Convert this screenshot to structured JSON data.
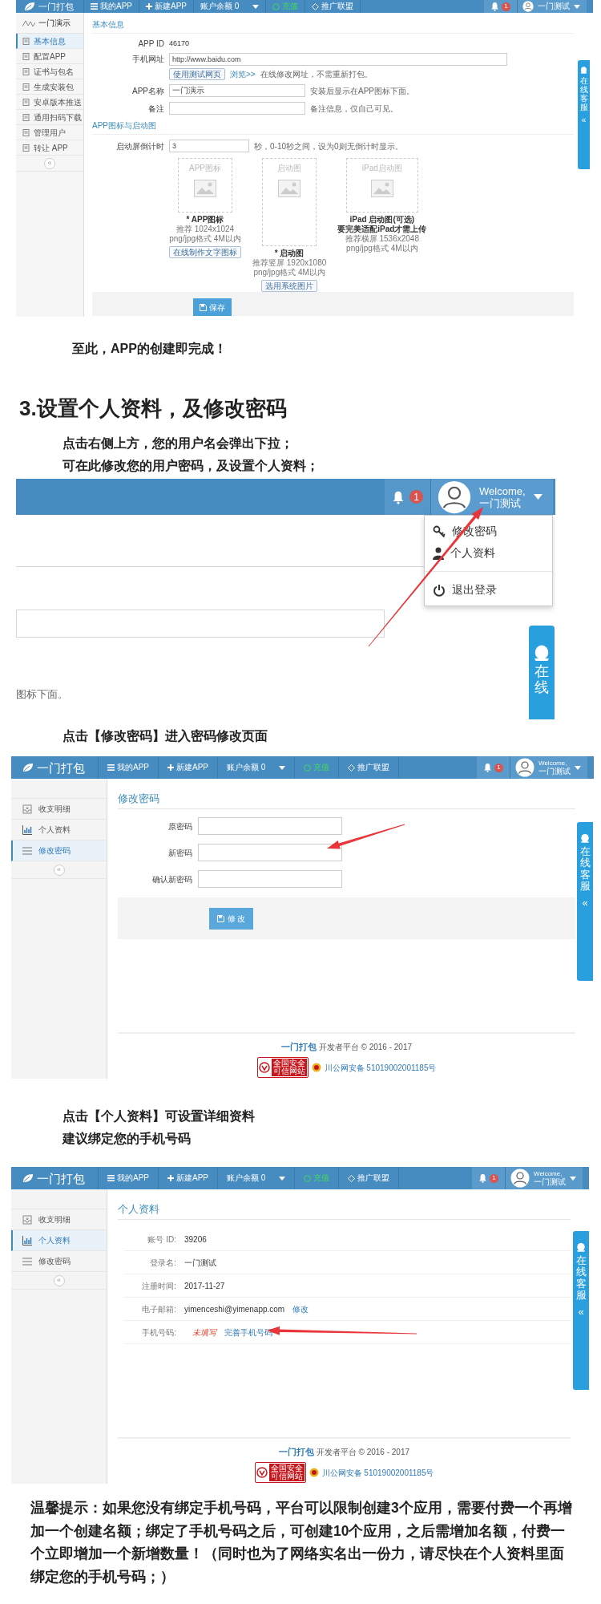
{
  "shot_app_settings": {
    "navbar": {
      "logo": "一门打包",
      "items": [
        {
          "kind": "menu",
          "label": "我的APP"
        },
        {
          "kind": "add",
          "label": "新建APP"
        },
        {
          "kind": "dropdown",
          "label": "账户余额 0"
        },
        {
          "kind": "recharge",
          "label": "充值"
        },
        {
          "kind": "promo",
          "label": "推广联盟"
        }
      ],
      "notification_count": "1",
      "user_name": "一门测试"
    },
    "sidebar": {
      "title": "一门演示",
      "items": [
        {
          "label": "基本信息",
          "selected": true
        },
        {
          "label": "配置APP",
          "selected": false
        },
        {
          "label": "证书与包名",
          "selected": false
        },
        {
          "label": "生成安装包",
          "selected": false
        },
        {
          "label": "安卓版本推送",
          "selected": false
        },
        {
          "label": "通用扫码下载",
          "selected": false
        },
        {
          "label": "管理用户",
          "selected": false
        },
        {
          "label": "转让 APP",
          "selected": false
        }
      ],
      "collapse": "«"
    },
    "basic_info": {
      "title": "基本信息",
      "app_id": {
        "label": "APP ID",
        "value": "46170"
      },
      "mobile_url": {
        "label": "手机网址",
        "value": "http://www.baidu.com",
        "test_button": "使用测试网页",
        "browse_link": "浏览>>",
        "hint": "在线修改网址，不需重新打包。"
      },
      "app_name": {
        "label": "APP名称",
        "value": "一门演示",
        "hint": "安装后显示在APP图标下面。"
      },
      "remark": {
        "label": "备注",
        "hint": "备注信息，仅自己可见。"
      }
    },
    "icons_section": {
      "title": "APP图标与启动图",
      "countdown": {
        "label": "启动屏倒计时",
        "value": "3",
        "hint": "秒，0-10秒之间，设为0则无倒计时显示。"
      },
      "uploads": [
        {
          "kind": "square",
          "box_label": "APP图标",
          "captions": [
            "* APP图标"
          ],
          "notes": [
            "推荐 1024x1024",
            "png/jpg格式 4M以内"
          ],
          "button": "在线制作文字图标"
        },
        {
          "kind": "tall",
          "box_label": "启动图",
          "captions": [
            "* 启动图"
          ],
          "notes": [
            "推荐竖屏 1920x1080",
            "png/jpg格式 4M以内"
          ],
          "button": "选用系统图片"
        },
        {
          "kind": "wide",
          "box_label": "iPad启动图",
          "captions": [
            "iPad 启动图(可选)",
            "要完美适配iPad才需上传"
          ],
          "notes": [
            "推荐横屏 1536x2048",
            "png/jpg格式 4M以内"
          ]
        }
      ]
    },
    "save_button": "保存",
    "support_tab": {
      "label": "在线客服",
      "arrow": "«"
    }
  },
  "completion_note": "至此，APP的创建即完成！",
  "section_heading": "3.设置个人资料，及修改密码",
  "section_intro": [
    "点击右侧上方，您的用户名会弹出下拉；",
    "可在此修改您的用户密码，及设置个人资料；"
  ],
  "shot_user_menu": {
    "notification_count": "1",
    "greeting": "Welcome,",
    "user_name": "一门测试",
    "menu": [
      {
        "kind": "key",
        "label": "修改密码"
      },
      {
        "kind": "user",
        "label": "个人资料"
      },
      {
        "kind": "divider"
      },
      {
        "kind": "power",
        "label": "退出登录"
      }
    ],
    "background_text": "图标下面。",
    "support_tab": {
      "label": "在线"
    }
  },
  "password_intro": [
    "点击【修改密码】进入密码修改页面"
  ],
  "shot_change_password": {
    "navbar": {
      "logo": "一门打包",
      "items": [
        {
          "kind": "menu",
          "label": "我的APP"
        },
        {
          "kind": "add",
          "label": "新建APP"
        },
        {
          "kind": "dropdown",
          "label": "账户余额 0"
        },
        {
          "kind": "recharge",
          "label": "充值"
        },
        {
          "kind": "promo",
          "label": "推广联盟"
        }
      ],
      "notification_count": "1",
      "greeting": "Welcome,",
      "user_name": "一门测试"
    },
    "sidebar": {
      "items": [
        {
          "label": "收支明细",
          "selected": false
        },
        {
          "label": "个人资料",
          "selected": false
        },
        {
          "label": "修改密码",
          "selected": true
        }
      ],
      "collapse": "«"
    },
    "title": "修改密码",
    "fields": [
      {
        "label": "原密码"
      },
      {
        "label": "新密码"
      },
      {
        "label": "确认新密码"
      }
    ],
    "submit_button": "修 改",
    "support_tab": {
      "label": "在线客服",
      "arrow": "«"
    },
    "footer": {
      "brand": "一门打包",
      "text": "开发者平台 © 2016 - 2017",
      "trust_seal": [
        "全国安全",
        "可信网站"
      ],
      "record": "川公网安备 51019002001185号"
    }
  },
  "profile_intro": [
    "点击【个人资料】可设置详细资料",
    "建议绑定您的手机号码"
  ],
  "shot_profile": {
    "navbar": {
      "logo": "一门打包",
      "items": [
        {
          "kind": "menu",
          "label": "我的APP"
        },
        {
          "kind": "add",
          "label": "新建APP"
        },
        {
          "kind": "dropdown",
          "label": "账户余额 0"
        },
        {
          "kind": "recharge",
          "label": "充值"
        },
        {
          "kind": "promo",
          "label": "推广联盟"
        }
      ],
      "notification_count": "1",
      "greeting": "Welcome,",
      "user_name": "一门测试"
    },
    "sidebar": {
      "items": [
        {
          "label": "收支明细",
          "selected": false
        },
        {
          "label": "个人资料",
          "selected": true
        },
        {
          "label": "修改密码",
          "selected": false
        }
      ],
      "collapse": "«"
    },
    "title": "个人资料",
    "rows": [
      {
        "label": "账号 ID:",
        "value": "39206"
      },
      {
        "label": "登录名:",
        "value": "一门测试"
      },
      {
        "label": "注册时间:",
        "value": "2017-11-27"
      },
      {
        "label": "电子邮箱:",
        "value": "yimenceshi@yimenapp.com",
        "link": "修改"
      },
      {
        "label": "手机号码:",
        "status": "未填写",
        "link": "完善手机号码"
      }
    ],
    "support_tab": {
      "label": "在线客服",
      "arrow": "«"
    },
    "footer": {
      "brand": "一门打包",
      "text": "开发者平台 © 2016 - 2017",
      "trust_seal": [
        "全国安全",
        "可信网站"
      ],
      "record": "川公网安备 51019002001185号"
    }
  },
  "tip": "温馨提示：如果您没有绑定手机号码，平台可以限制创建3个应用，需要付费一个再增加一个创建名额；绑定了手机号码之后，可创建10个应用，之后需增加名额，付费一个立即增加一个新增数量！（同时也为了网络实名出一份力，请尽快在个人资料里面绑定您的手机号码；）"
}
